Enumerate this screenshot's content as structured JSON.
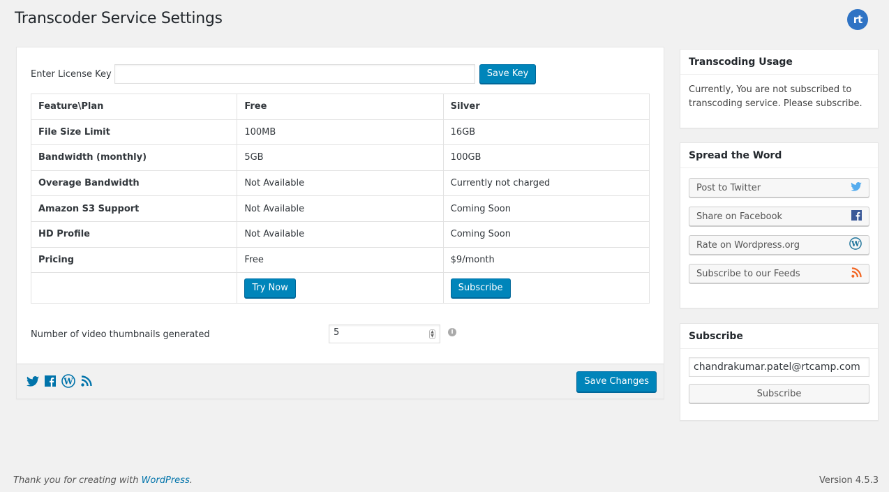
{
  "header": {
    "title": "Transcoder Service Settings",
    "logo_text": "rt",
    "logo_icon": "rtcamp-logo-icon"
  },
  "license": {
    "label": "Enter License Key",
    "value": "",
    "placeholder": "",
    "save_label": "Save Key"
  },
  "plans_table": {
    "headers": [
      "Feature\\Plan",
      "Free",
      "Silver"
    ],
    "rows": [
      [
        "File Size Limit",
        "100MB",
        "16GB"
      ],
      [
        "Bandwidth (monthly)",
        "5GB",
        "100GB"
      ],
      [
        "Overage Bandwidth",
        "Not Available",
        "Currently not charged"
      ],
      [
        "Amazon S3 Support",
        "Not Available",
        "Coming Soon"
      ],
      [
        "HD Profile",
        "Not Available",
        "Coming Soon"
      ],
      [
        "Pricing",
        "Free",
        "$9/month"
      ]
    ],
    "actions": {
      "free": "Try Now",
      "silver": "Subscribe"
    }
  },
  "thumbnails": {
    "label": "Number of video thumbnails generated",
    "value": "5",
    "info_icon": "i"
  },
  "main_footer": {
    "icons": [
      "twitter-icon",
      "facebook-icon",
      "wordpress-icon",
      "rss-icon"
    ],
    "save_label": "Save Changes"
  },
  "sidebar": {
    "usage": {
      "title": "Transcoding Usage",
      "text": "Currently, You are not subscribed to transcoding service. Please subscribe."
    },
    "spread": {
      "title": "Spread the Word",
      "buttons": [
        {
          "label": "Post to Twitter",
          "icon": "twitter-icon",
          "color": "#55acee"
        },
        {
          "label": "Share on Facebook",
          "icon": "facebook-icon",
          "color": "#3b5998"
        },
        {
          "label": "Rate on Wordpress.org",
          "icon": "wordpress-icon",
          "color": "#21759b"
        },
        {
          "label": "Subscribe to our Feeds",
          "icon": "rss-icon",
          "color": "#f26522"
        }
      ]
    },
    "subscribe": {
      "title": "Subscribe",
      "email": "chandrakumar.patel@rtcamp.com",
      "button_label": "Subscribe"
    }
  },
  "footer": {
    "thanks_prefix": "Thank you for creating with ",
    "thanks_link": "WordPress",
    "thanks_suffix": ".",
    "version": "Version 4.5.3"
  },
  "colors": {
    "primary": "#0085ba",
    "link": "#0073aa",
    "background": "#f1f1f1"
  }
}
